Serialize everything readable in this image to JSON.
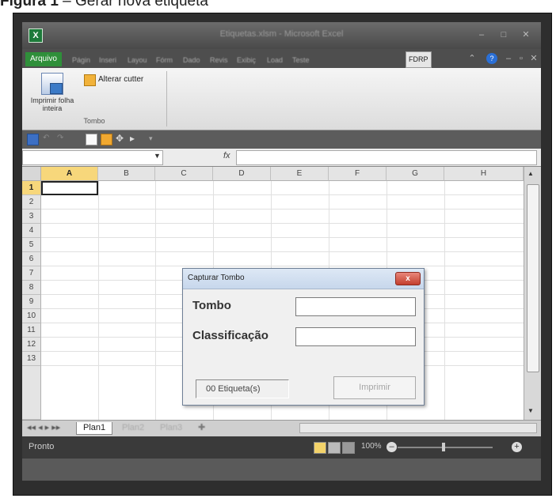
{
  "caption": {
    "prefix": "Figura 1",
    "text": " – Gerar nova etiqueta"
  },
  "window": {
    "title": "Etiquetas.xlsm - Microsoft Excel",
    "logo": "X"
  },
  "ribbon_tabs": [
    "Arquivo",
    "Págin",
    "Inseri",
    "Layou",
    "Fórm",
    "Dado",
    "Revis",
    "Exibiç",
    "Load",
    "Teste",
    "FDRP"
  ],
  "ribbon": {
    "big_button_label": "Imprimir folha inteira",
    "small_button_label": "Alterar cutter",
    "group_label": "Tombo"
  },
  "formula_bar": {
    "fx": "fx",
    "name_box": ""
  },
  "columns": [
    "A",
    "B",
    "C",
    "D",
    "E",
    "F",
    "G",
    "H"
  ],
  "rows": [
    "1",
    "2",
    "3",
    "4",
    "5",
    "6",
    "7",
    "8",
    "9",
    "10",
    "11",
    "12",
    "13"
  ],
  "sheets": [
    "Plan1",
    "Plan2",
    "Plan3"
  ],
  "status": {
    "text": "Pronto",
    "zoom": "100%"
  },
  "dialog": {
    "title": "Capturar Tombo",
    "close_label": "x",
    "tombo_label": "Tombo",
    "classificacao_label": "Classificação",
    "tombo_value": "",
    "classificacao_value": "",
    "counter": "00 Etiqueta(s)",
    "print_label": "Imprimir"
  },
  "colors": {
    "arquivo_tab": "#2f8f3a",
    "selected_header": "#f7d77b",
    "close_button": "#c33f2e",
    "help_icon": "#2a6fd6"
  }
}
